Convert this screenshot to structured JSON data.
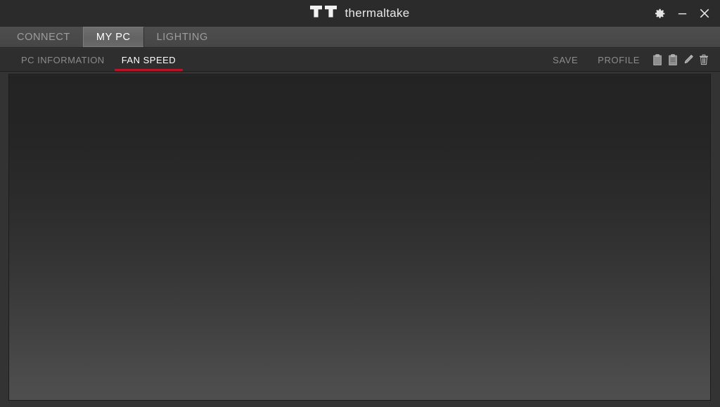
{
  "app": {
    "brand_name": "thermaltake",
    "brand_logo_icon": "thermaltake-tt-logo"
  },
  "titlebar": {
    "settings_icon": "gear-icon",
    "minimize_icon": "minimize-icon",
    "close_icon": "close-icon"
  },
  "main_nav": {
    "tabs": [
      {
        "label": "CONNECT",
        "active": false
      },
      {
        "label": "MY PC",
        "active": true
      },
      {
        "label": "LIGHTING",
        "active": false
      }
    ]
  },
  "sub_nav": {
    "tabs": [
      {
        "label": "PC INFORMATION",
        "active": false
      },
      {
        "label": "FAN SPEED",
        "active": true
      }
    ],
    "actions": [
      {
        "label": "SAVE"
      },
      {
        "label": "PROFILE"
      }
    ],
    "icons": [
      {
        "name": "copy-icon"
      },
      {
        "name": "paste-icon"
      },
      {
        "name": "edit-pencil-icon"
      },
      {
        "name": "delete-trash-icon"
      }
    ]
  },
  "content": {
    "empty": true
  },
  "colors": {
    "accent_red": "#b81528",
    "titlebar_bg": "#2b2b2b",
    "nav_bg": "#484848",
    "subnav_bg": "#2e2e2e",
    "panel_top": "#232323",
    "panel_bottom": "#4e4e4e",
    "text_inactive": "#8c8c8c",
    "text_active": "#ffffff"
  }
}
